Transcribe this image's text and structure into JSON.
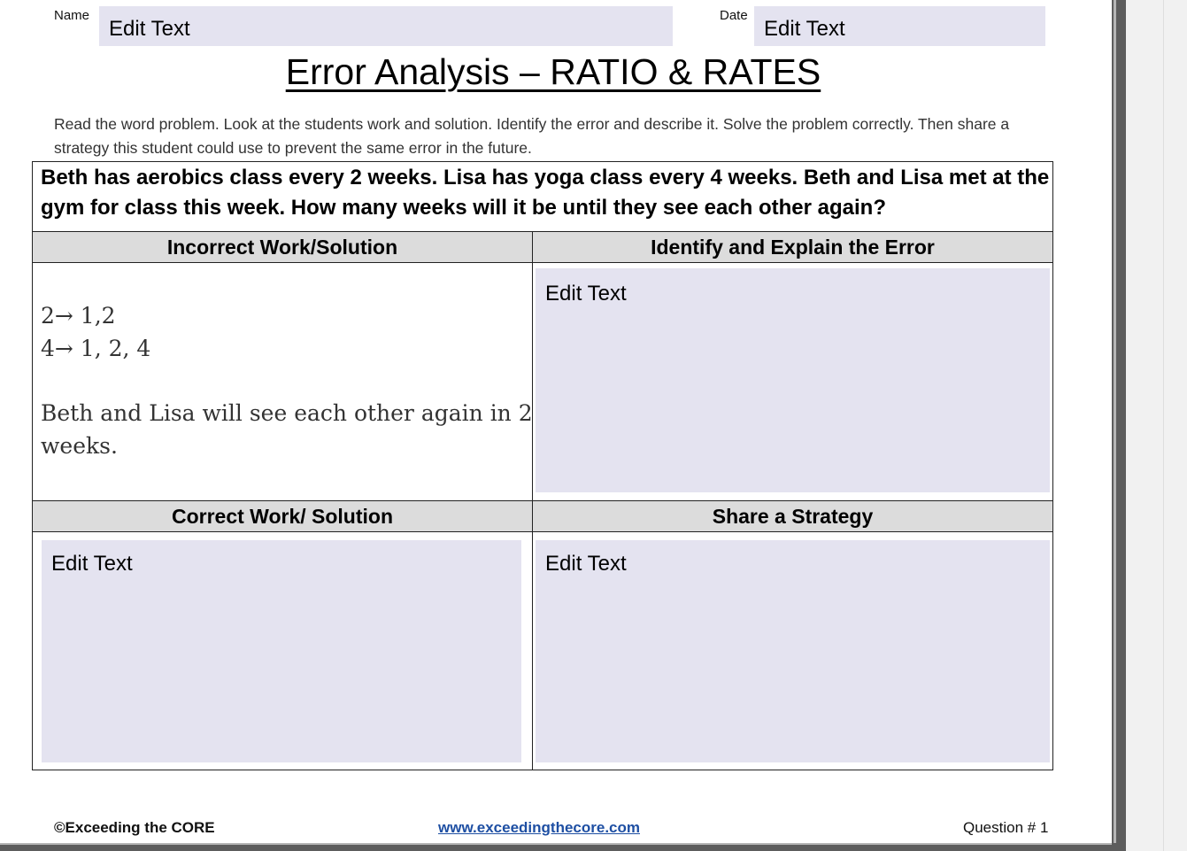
{
  "header": {
    "name_label": "Name",
    "name_value": "Edit Text",
    "date_label": "Date",
    "date_value": "Edit Text"
  },
  "title": "Error Analysis – RATIO & RATES",
  "instructions": "Read the word problem. Look at the students work and solution.  Identify the error and describe it. Solve the problem correctly.  Then share a strategy this student could use to prevent the same error in the future.",
  "problem": "Beth has aerobics class every 2 weeks.  Lisa has yoga class every 4 weeks.  Beth and Lisa met at the gym for class this week.  How many weeks will it be until they see each other again?",
  "sections": {
    "incorrect_header": "Incorrect Work/Solution",
    "identify_header": "Identify and Explain the Error",
    "correct_header": "Correct Work/ Solution",
    "strategy_header": "Share a Strategy"
  },
  "student_work": {
    "line1": "2→ 1,2",
    "line2": "4→ 1, 2, 4",
    "answer_line1": "Beth and Lisa will see each other again in 2",
    "answer_line2": "weeks."
  },
  "fields": {
    "identify": "Edit Text",
    "correct": "Edit Text",
    "strategy": "Edit Text"
  },
  "footer": {
    "copyright": "©Exceeding the CORE",
    "link": "www.exceedingthecore.com",
    "question": "Question # 1"
  },
  "colors": {
    "field_background": "#e4e3f0",
    "header_background": "#dcdcdc",
    "link": "#1e4fa3"
  }
}
